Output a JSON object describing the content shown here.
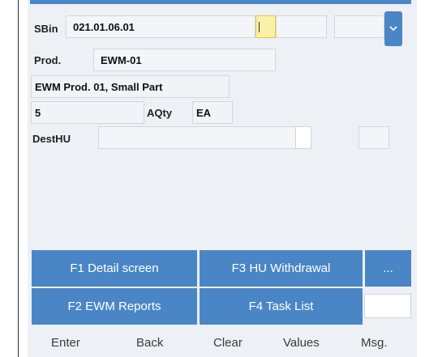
{
  "form": {
    "sbin_label": "SBin",
    "sbin_value": "021.01.06.01",
    "prod_label": "Prod.",
    "prod_value": "EWM-01",
    "description": "EWM Prod. 01, Small Part",
    "qty_value": "5",
    "aqty_label": "AQty",
    "uom_value": "EA",
    "desthu_label": "DestHU",
    "dropdown_icon": "chevron-down-icon"
  },
  "function_keys": {
    "f1": "F1 Detail screen",
    "f3": "F3 HU Withdrawal",
    "more": "...",
    "f2": "F2 EWM Reports",
    "f4": "F4 Task List"
  },
  "nav": {
    "enter": "Enter",
    "back": "Back",
    "clear": "Clear",
    "values": "Values",
    "msg": "Msg."
  },
  "colors": {
    "accent": "#4a86c6",
    "background": "#edf0f4",
    "input_highlight": "#fbf0a8"
  }
}
